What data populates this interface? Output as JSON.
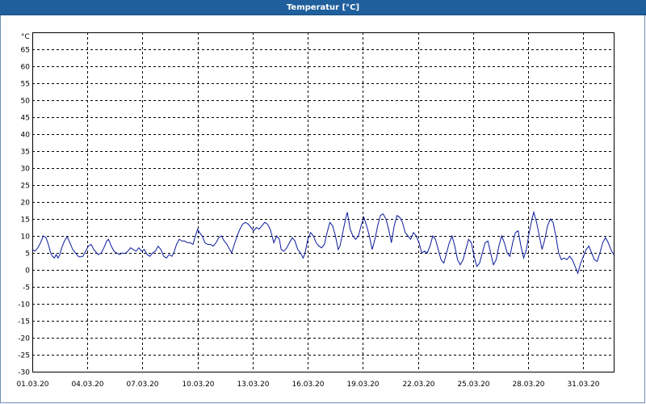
{
  "window": {
    "title": "Temperatur [°C]"
  },
  "chart_data": {
    "type": "line",
    "title": "Temperatur [°C]",
    "ylabel": "°C",
    "xlabel": "",
    "ylim": [
      -30,
      70
    ],
    "yticks": [
      -30,
      -25,
      -20,
      -15,
      -10,
      -5,
      0,
      5,
      10,
      15,
      20,
      25,
      30,
      35,
      40,
      45,
      50,
      55,
      60,
      65
    ],
    "xticks": [
      "01.03.20",
      "04.03.20",
      "07.03.20",
      "10.03.20",
      "13.03.20",
      "16.03.20",
      "19.03.20",
      "22.03.20",
      "25.03.20",
      "28.03.20",
      "31.03.20"
    ],
    "grid": true,
    "series_color": "#0a1a9a",
    "x_unit": "days since 01.03.20",
    "series": [
      {
        "values": [
          [
            0.0,
            6
          ],
          [
            0.15,
            5.5
          ],
          [
            0.3,
            6.5
          ],
          [
            0.45,
            8
          ],
          [
            0.6,
            10
          ],
          [
            0.75,
            9.5
          ],
          [
            0.9,
            7
          ],
          [
            1.0,
            5
          ],
          [
            1.1,
            4
          ],
          [
            1.2,
            3.5
          ],
          [
            1.3,
            4.5
          ],
          [
            1.4,
            3.5
          ],
          [
            1.5,
            4.5
          ],
          [
            1.6,
            6.5
          ],
          [
            1.75,
            8.5
          ],
          [
            1.9,
            9.8
          ],
          [
            2.05,
            8
          ],
          [
            2.2,
            6
          ],
          [
            2.35,
            5
          ],
          [
            2.5,
            4
          ],
          [
            2.6,
            3.8
          ],
          [
            2.75,
            4
          ],
          [
            2.9,
            5.5
          ],
          [
            3.05,
            7
          ],
          [
            3.2,
            7.5
          ],
          [
            3.35,
            6
          ],
          [
            3.5,
            5
          ],
          [
            3.6,
            4.5
          ],
          [
            3.75,
            5
          ],
          [
            3.9,
            6.5
          ],
          [
            4.05,
            8.5
          ],
          [
            4.15,
            9
          ],
          [
            4.3,
            7
          ],
          [
            4.45,
            5.5
          ],
          [
            4.6,
            5
          ],
          [
            4.75,
            4.5
          ],
          [
            4.9,
            5
          ],
          [
            5.05,
            4.8
          ],
          [
            5.2,
            5.5
          ],
          [
            5.35,
            6.5
          ],
          [
            5.5,
            6
          ],
          [
            5.65,
            5.5
          ],
          [
            5.8,
            6.5
          ],
          [
            5.95,
            5.5
          ],
          [
            6.1,
            6
          ],
          [
            6.25,
            4.5
          ],
          [
            6.4,
            4
          ],
          [
            6.55,
            5
          ],
          [
            6.7,
            5.5
          ],
          [
            6.85,
            7
          ],
          [
            7.0,
            6
          ],
          [
            7.15,
            4
          ],
          [
            7.3,
            3.5
          ],
          [
            7.45,
            4.5
          ],
          [
            7.6,
            4
          ],
          [
            7.7,
            5
          ],
          [
            7.85,
            7.5
          ],
          [
            8.0,
            9
          ],
          [
            8.15,
            8.5
          ],
          [
            8.3,
            8.5
          ],
          [
            8.45,
            8
          ],
          [
            8.6,
            8
          ],
          [
            8.75,
            7.5
          ],
          [
            8.85,
            9.5
          ],
          [
            9.0,
            12
          ],
          [
            9.1,
            11
          ],
          [
            9.25,
            10
          ],
          [
            9.4,
            8
          ],
          [
            9.55,
            7.5
          ],
          [
            9.7,
            7.5
          ],
          [
            9.85,
            7
          ],
          [
            10.0,
            8
          ],
          [
            10.15,
            9.5
          ],
          [
            10.3,
            10
          ],
          [
            10.45,
            8.5
          ],
          [
            10.6,
            7.5
          ],
          [
            10.75,
            6
          ],
          [
            10.85,
            5
          ],
          [
            11.0,
            7.5
          ],
          [
            11.15,
            10
          ],
          [
            11.3,
            12
          ],
          [
            11.45,
            13.5
          ],
          [
            11.6,
            14
          ],
          [
            11.75,
            13.5
          ],
          [
            11.9,
            12.5
          ],
          [
            12.05,
            11.5
          ],
          [
            12.2,
            12.5
          ],
          [
            12.35,
            12
          ],
          [
            12.5,
            13
          ],
          [
            12.65,
            14
          ],
          [
            12.8,
            13.5
          ],
          [
            12.95,
            12
          ],
          [
            13.05,
            10
          ],
          [
            13.15,
            8
          ],
          [
            13.3,
            10
          ],
          [
            13.45,
            9
          ],
          [
            13.55,
            6
          ],
          [
            13.7,
            5.5
          ],
          [
            13.85,
            6.5
          ],
          [
            14.0,
            8
          ],
          [
            14.15,
            9.5
          ],
          [
            14.3,
            8.5
          ],
          [
            14.45,
            6
          ],
          [
            14.6,
            5
          ],
          [
            14.75,
            3.5
          ],
          [
            14.85,
            5
          ],
          [
            15.0,
            9
          ],
          [
            15.15,
            11
          ],
          [
            15.3,
            10
          ],
          [
            15.45,
            8
          ],
          [
            15.6,
            7
          ],
          [
            15.75,
            6.5
          ],
          [
            15.9,
            7.5
          ],
          [
            16.05,
            11
          ],
          [
            16.2,
            14
          ],
          [
            16.35,
            13
          ],
          [
            16.5,
            10
          ],
          [
            16.65,
            6
          ],
          [
            16.75,
            7
          ],
          [
            16.9,
            11
          ],
          [
            17.05,
            15
          ],
          [
            17.15,
            17
          ],
          [
            17.3,
            12
          ],
          [
            17.45,
            10
          ],
          [
            17.6,
            9
          ],
          [
            17.75,
            10
          ],
          [
            17.9,
            13
          ],
          [
            18.05,
            15.5
          ],
          [
            18.2,
            13
          ],
          [
            18.35,
            10
          ],
          [
            18.5,
            6
          ],
          [
            18.65,
            9
          ],
          [
            18.8,
            13
          ],
          [
            18.95,
            16
          ],
          [
            19.1,
            16.5
          ],
          [
            19.25,
            15
          ],
          [
            19.4,
            12
          ],
          [
            19.55,
            8
          ],
          [
            19.7,
            13
          ],
          [
            19.85,
            16
          ],
          [
            20.0,
            15.5
          ],
          [
            20.15,
            14
          ],
          [
            20.3,
            11
          ],
          [
            20.45,
            10
          ],
          [
            20.6,
            9
          ],
          [
            20.75,
            11
          ],
          [
            20.9,
            10
          ],
          [
            21.05,
            8
          ],
          [
            21.2,
            5
          ],
          [
            21.35,
            5.5
          ],
          [
            21.5,
            5
          ],
          [
            21.65,
            7
          ],
          [
            21.8,
            10
          ],
          [
            21.95,
            9
          ],
          [
            22.1,
            6
          ],
          [
            22.25,
            3
          ],
          [
            22.4,
            2
          ],
          [
            22.55,
            5
          ],
          [
            22.7,
            8
          ],
          [
            22.85,
            10
          ],
          [
            23.0,
            7
          ],
          [
            23.15,
            3
          ],
          [
            23.3,
            1.5
          ],
          [
            23.45,
            3
          ],
          [
            23.6,
            6
          ],
          [
            23.75,
            9
          ],
          [
            23.9,
            8
          ],
          [
            24.05,
            4
          ],
          [
            24.2,
            1
          ],
          [
            24.35,
            2
          ],
          [
            24.5,
            5
          ],
          [
            24.65,
            8
          ],
          [
            24.8,
            8.5
          ],
          [
            24.95,
            5
          ],
          [
            25.1,
            1.5
          ],
          [
            25.25,
            3
          ],
          [
            25.4,
            7
          ],
          [
            25.55,
            10
          ],
          [
            25.7,
            8
          ],
          [
            25.85,
            5
          ],
          [
            26.0,
            4
          ],
          [
            26.15,
            8
          ],
          [
            26.3,
            11
          ],
          [
            26.45,
            11.5
          ],
          [
            26.6,
            7
          ],
          [
            26.75,
            3.5
          ],
          [
            26.9,
            6
          ],
          [
            27.05,
            11
          ],
          [
            27.2,
            15
          ],
          [
            27.3,
            17
          ],
          [
            27.45,
            14
          ],
          [
            27.6,
            10
          ],
          [
            27.75,
            6
          ],
          [
            27.9,
            9
          ],
          [
            28.05,
            13
          ],
          [
            28.2,
            15
          ],
          [
            28.35,
            14
          ],
          [
            28.5,
            10
          ],
          [
            28.65,
            5
          ],
          [
            28.8,
            3
          ],
          [
            28.95,
            3.5
          ],
          [
            29.1,
            3
          ],
          [
            29.25,
            4
          ],
          [
            29.4,
            3
          ],
          [
            29.55,
            1
          ],
          [
            29.7,
            -1
          ],
          [
            29.85,
            2
          ],
          [
            30.0,
            4
          ],
          [
            30.15,
            6
          ],
          [
            30.3,
            7
          ],
          [
            30.45,
            5
          ],
          [
            30.6,
            3
          ],
          [
            30.75,
            2.5
          ],
          [
            30.9,
            5
          ],
          [
            31.05,
            8
          ],
          [
            31.2,
            9.5
          ],
          [
            31.35,
            8
          ],
          [
            31.5,
            6
          ],
          [
            31.65,
            4.5
          ]
        ]
      }
    ]
  }
}
